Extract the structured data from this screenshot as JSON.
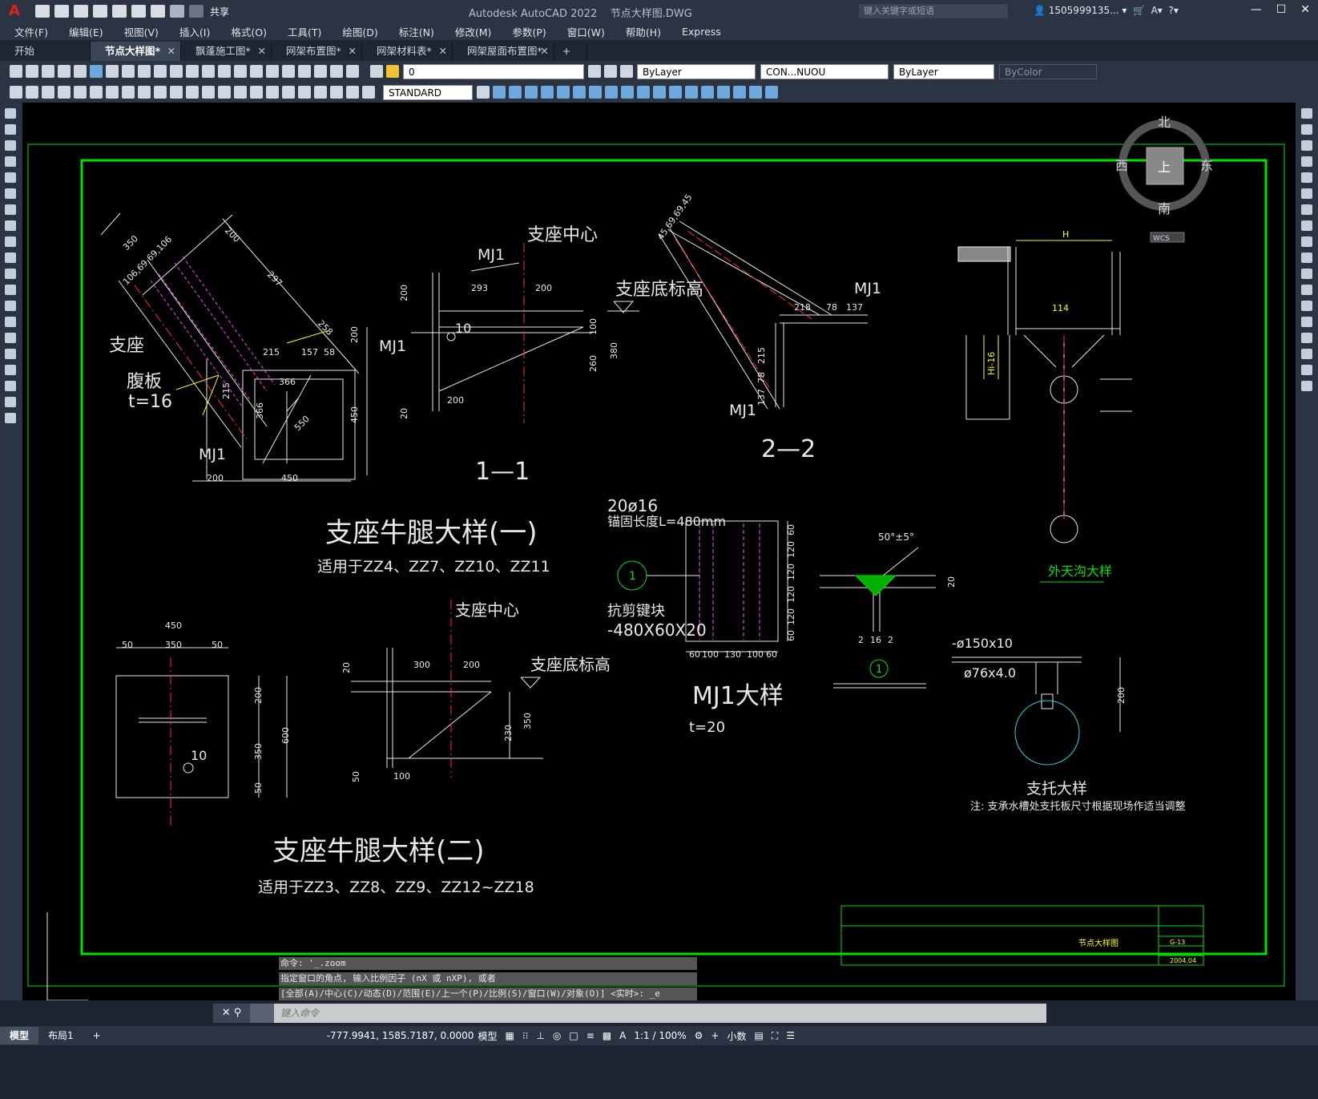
{
  "app": {
    "title": "Autodesk AutoCAD 2022",
    "file": "节点大样图.DWG",
    "share_label": "共享",
    "search_placeholder": "键入关键字或短语",
    "user": "1505999135...",
    "logo": "A"
  },
  "menu": [
    "文件(F)",
    "编辑(E)",
    "视图(V)",
    "插入(I)",
    "格式(O)",
    "工具(T)",
    "绘图(D)",
    "标注(N)",
    "修改(M)",
    "参数(P)",
    "窗口(W)",
    "帮助(H)",
    "Express"
  ],
  "tabs": [
    {
      "label": "开始",
      "close": false,
      "active": false
    },
    {
      "label": "节点大样图*",
      "close": true,
      "active": true
    },
    {
      "label": "飘蓬施工图*",
      "close": true,
      "active": false
    },
    {
      "label": "网架布置图*",
      "close": true,
      "active": false
    },
    {
      "label": "网架材料表*",
      "close": true,
      "active": false
    },
    {
      "label": "网架屋面布置图*",
      "close": true,
      "active": false
    }
  ],
  "toolbar": {
    "layer": "0",
    "color": "ByLayer",
    "linetype": "CON...NUOU",
    "lineweight": "ByLayer",
    "plotstyle": "ByColor",
    "textstyle": "STANDARD"
  },
  "viewcube": {
    "north": "北",
    "south": "南",
    "east": "东",
    "west": "西",
    "top": "上",
    "wcs": "WCS"
  },
  "drawing": {
    "detail1_title": "支座牛腿大样(一)",
    "detail1_sub": "适用于ZZ4、ZZ7、ZZ10、ZZ11",
    "detail2_title": "支座牛腿大样(二)",
    "detail2_sub": "适用于ZZ3、ZZ8、ZZ9、ZZ12~ZZ18",
    "sec11": "1—1",
    "sec22": "2—2",
    "support_center": "支座中心",
    "support_elev": "支座底标高",
    "mj1": "MJ1",
    "support": "支座",
    "web": "腹板",
    "t16": "t=16",
    "mj1_title": "MJ1大样",
    "t20": "t=20",
    "bolts": "20ø16",
    "anchor": "锚固长度L=480mm",
    "shear": "抗剪键块",
    "shear_size": "-480X60X20",
    "gutter": "外天沟大样",
    "bracket": "支托大样",
    "bracket_note": "注: 支承水槽处支托板尺寸根据现场作适当调整",
    "plate": "-ø150x10",
    "pipe": "ø76x4.0",
    "tb_name": "节点大样图",
    "tb_no": "G-13",
    "tb_date": "2004.04",
    "weld": "50°±5°",
    "marker": "1"
  },
  "dims": {
    "d200": "200",
    "d350": "350",
    "d297": "297",
    "d258": "258",
    "d215": "215",
    "d157": "157",
    "d58": "58",
    "d366": "366",
    "d550": "550",
    "d450": "450",
    "d293": "293",
    "d100": "100",
    "d380": "380",
    "d260": "260",
    "d20": "20",
    "d10": "10",
    "d218": "218",
    "d78": "78",
    "d137": "137",
    "d60": "60",
    "d120": "120",
    "d130": "130",
    "d300": "300",
    "d230": "230",
    "d50": "50",
    "d600": "600",
    "d2": "2",
    "d16": "16",
    "d114": "114",
    "d106": "106,69,69,106",
    "d45": "45,69,69,45",
    "h": "H",
    "dm": "Hi-16"
  },
  "command": {
    "hist1": "命令: '_.zoom",
    "hist2": "指定窗口的角点, 输入比例因子 (nX 或 nXP), 或者",
    "hist3": "[全部(A)/中心(C)/动态(D)/范围(E)/上一个(P)/比例(S)/窗口(W)/对象(O)] <实时>: _e",
    "placeholder": "键入命令"
  },
  "status": {
    "model_tab": "模型",
    "layout_tab": "布局1",
    "coords": "-777.9941, 1585.7187, 0.0000",
    "space": "模型",
    "scale": "1:1 / 100%",
    "units": "小数"
  },
  "colors": {
    "accent_green": "#00e000",
    "red": "#ff2b2b",
    "magenta": "#ff40ff",
    "yellow": "#ffff00",
    "cyan": "#20d8e0"
  }
}
